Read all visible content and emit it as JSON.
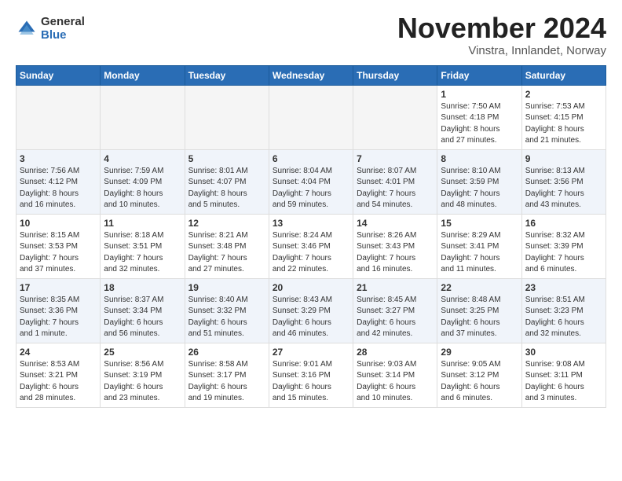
{
  "logo": {
    "general": "General",
    "blue": "Blue"
  },
  "title": "November 2024",
  "location": "Vinstra, Innlandet, Norway",
  "headers": [
    "Sunday",
    "Monday",
    "Tuesday",
    "Wednesday",
    "Thursday",
    "Friday",
    "Saturday"
  ],
  "weeks": [
    {
      "shade": false,
      "days": [
        {
          "num": "",
          "info": ""
        },
        {
          "num": "",
          "info": ""
        },
        {
          "num": "",
          "info": ""
        },
        {
          "num": "",
          "info": ""
        },
        {
          "num": "",
          "info": ""
        },
        {
          "num": "1",
          "info": "Sunrise: 7:50 AM\nSunset: 4:18 PM\nDaylight: 8 hours\nand 27 minutes."
        },
        {
          "num": "2",
          "info": "Sunrise: 7:53 AM\nSunset: 4:15 PM\nDaylight: 8 hours\nand 21 minutes."
        }
      ]
    },
    {
      "shade": true,
      "days": [
        {
          "num": "3",
          "info": "Sunrise: 7:56 AM\nSunset: 4:12 PM\nDaylight: 8 hours\nand 16 minutes."
        },
        {
          "num": "4",
          "info": "Sunrise: 7:59 AM\nSunset: 4:09 PM\nDaylight: 8 hours\nand 10 minutes."
        },
        {
          "num": "5",
          "info": "Sunrise: 8:01 AM\nSunset: 4:07 PM\nDaylight: 8 hours\nand 5 minutes."
        },
        {
          "num": "6",
          "info": "Sunrise: 8:04 AM\nSunset: 4:04 PM\nDaylight: 7 hours\nand 59 minutes."
        },
        {
          "num": "7",
          "info": "Sunrise: 8:07 AM\nSunset: 4:01 PM\nDaylight: 7 hours\nand 54 minutes."
        },
        {
          "num": "8",
          "info": "Sunrise: 8:10 AM\nSunset: 3:59 PM\nDaylight: 7 hours\nand 48 minutes."
        },
        {
          "num": "9",
          "info": "Sunrise: 8:13 AM\nSunset: 3:56 PM\nDaylight: 7 hours\nand 43 minutes."
        }
      ]
    },
    {
      "shade": false,
      "days": [
        {
          "num": "10",
          "info": "Sunrise: 8:15 AM\nSunset: 3:53 PM\nDaylight: 7 hours\nand 37 minutes."
        },
        {
          "num": "11",
          "info": "Sunrise: 8:18 AM\nSunset: 3:51 PM\nDaylight: 7 hours\nand 32 minutes."
        },
        {
          "num": "12",
          "info": "Sunrise: 8:21 AM\nSunset: 3:48 PM\nDaylight: 7 hours\nand 27 minutes."
        },
        {
          "num": "13",
          "info": "Sunrise: 8:24 AM\nSunset: 3:46 PM\nDaylight: 7 hours\nand 22 minutes."
        },
        {
          "num": "14",
          "info": "Sunrise: 8:26 AM\nSunset: 3:43 PM\nDaylight: 7 hours\nand 16 minutes."
        },
        {
          "num": "15",
          "info": "Sunrise: 8:29 AM\nSunset: 3:41 PM\nDaylight: 7 hours\nand 11 minutes."
        },
        {
          "num": "16",
          "info": "Sunrise: 8:32 AM\nSunset: 3:39 PM\nDaylight: 7 hours\nand 6 minutes."
        }
      ]
    },
    {
      "shade": true,
      "days": [
        {
          "num": "17",
          "info": "Sunrise: 8:35 AM\nSunset: 3:36 PM\nDaylight: 7 hours\nand 1 minute."
        },
        {
          "num": "18",
          "info": "Sunrise: 8:37 AM\nSunset: 3:34 PM\nDaylight: 6 hours\nand 56 minutes."
        },
        {
          "num": "19",
          "info": "Sunrise: 8:40 AM\nSunset: 3:32 PM\nDaylight: 6 hours\nand 51 minutes."
        },
        {
          "num": "20",
          "info": "Sunrise: 8:43 AM\nSunset: 3:29 PM\nDaylight: 6 hours\nand 46 minutes."
        },
        {
          "num": "21",
          "info": "Sunrise: 8:45 AM\nSunset: 3:27 PM\nDaylight: 6 hours\nand 42 minutes."
        },
        {
          "num": "22",
          "info": "Sunrise: 8:48 AM\nSunset: 3:25 PM\nDaylight: 6 hours\nand 37 minutes."
        },
        {
          "num": "23",
          "info": "Sunrise: 8:51 AM\nSunset: 3:23 PM\nDaylight: 6 hours\nand 32 minutes."
        }
      ]
    },
    {
      "shade": false,
      "days": [
        {
          "num": "24",
          "info": "Sunrise: 8:53 AM\nSunset: 3:21 PM\nDaylight: 6 hours\nand 28 minutes."
        },
        {
          "num": "25",
          "info": "Sunrise: 8:56 AM\nSunset: 3:19 PM\nDaylight: 6 hours\nand 23 minutes."
        },
        {
          "num": "26",
          "info": "Sunrise: 8:58 AM\nSunset: 3:17 PM\nDaylight: 6 hours\nand 19 minutes."
        },
        {
          "num": "27",
          "info": "Sunrise: 9:01 AM\nSunset: 3:16 PM\nDaylight: 6 hours\nand 15 minutes."
        },
        {
          "num": "28",
          "info": "Sunrise: 9:03 AM\nSunset: 3:14 PM\nDaylight: 6 hours\nand 10 minutes."
        },
        {
          "num": "29",
          "info": "Sunrise: 9:05 AM\nSunset: 3:12 PM\nDaylight: 6 hours\nand 6 minutes."
        },
        {
          "num": "30",
          "info": "Sunrise: 9:08 AM\nSunset: 3:11 PM\nDaylight: 6 hours\nand 3 minutes."
        }
      ]
    }
  ]
}
